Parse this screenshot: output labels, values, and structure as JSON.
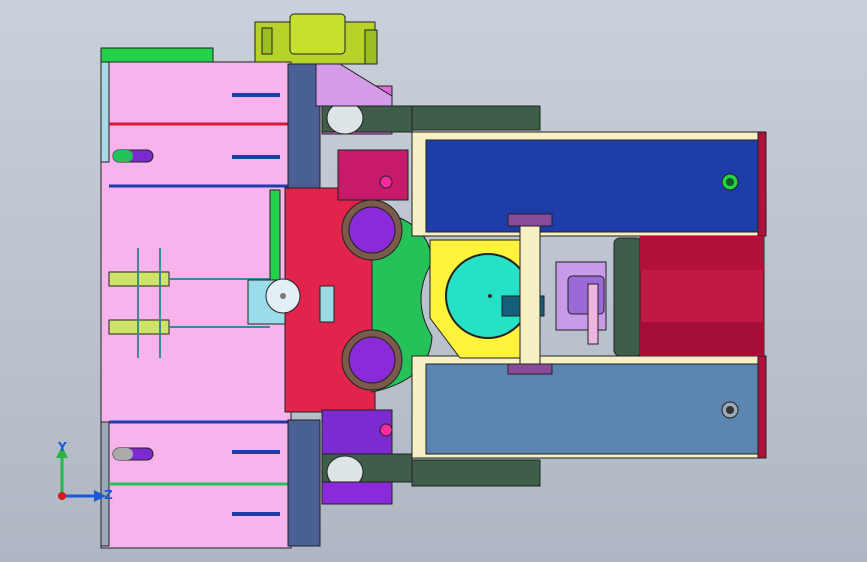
{
  "viewport": {
    "background_top": "#c9d0da",
    "background_bottom": "#aeb7c3"
  },
  "triad": {
    "y_label": "Y",
    "z_label": "Z",
    "y_color": "#2cb24a",
    "z_color": "#1b57d6",
    "origin_color": "#d21b1b"
  },
  "palette": {
    "pink": "#f7b4ec",
    "crimson": "#e2234c",
    "navy": "#1e3da8",
    "steel": "#5c84b0",
    "slate": "#4a5f93",
    "green": "#25c25a",
    "cyan": "#27e1c7",
    "yellow": "#fff23a",
    "purple": "#7d2bd0",
    "olive": "#b7d32a",
    "darkgreen": "#3e5e4a",
    "maroon": "#b1103a",
    "cream": "#f6f0c4"
  }
}
